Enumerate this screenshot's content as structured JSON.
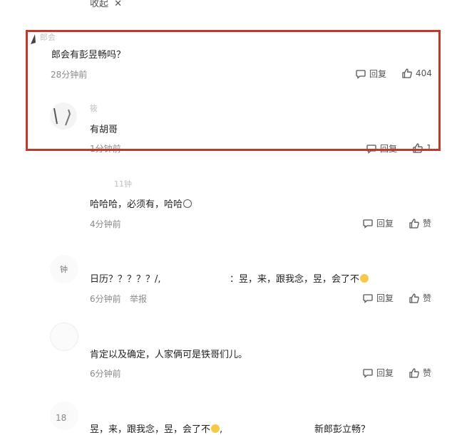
{
  "top": {
    "collapse_label": "收起"
  },
  "highlighted_thread": {
    "parent": {
      "username_partial": "郎会",
      "text": "郎会有彭昱畅吗？",
      "time": "28分钟前",
      "reply_label": "回复",
      "like_count": "404"
    },
    "reply": {
      "username_partial": "筱",
      "text": "有胡哥",
      "time": "1分钟前",
      "reply_label": "回复",
      "like_count": "1"
    }
  },
  "comments": [
    {
      "username_partial": "11钟",
      "text": "哈哈哈，必须有，哈哈",
      "time": "4分钟前",
      "reply_label": "回复",
      "like_label": "赞"
    },
    {
      "avatar_text": "钟",
      "text_a": "日历？？？？？/,",
      "text_b": "：昱，来，跟我念，昱，会了不",
      "time": "6分钟前",
      "report_label": "举报",
      "reply_label": "回复",
      "like_label": "赞"
    },
    {
      "text": "肯定以及确定，人家俩可是铁哥们儿。",
      "time": "6分钟前",
      "reply_label": "回复",
      "like_label": "赞"
    },
    {
      "avatar_text": "18",
      "text_a": "昱，来，跟我念，昱，会了不",
      "text_b": "新郎彭立畅？"
    }
  ],
  "colors": {
    "highlight_border": "#c0392b",
    "meta_gray": "#8a8a8a"
  },
  "icons": [
    "close-icon",
    "comment-icon",
    "thumb-up-icon"
  ]
}
